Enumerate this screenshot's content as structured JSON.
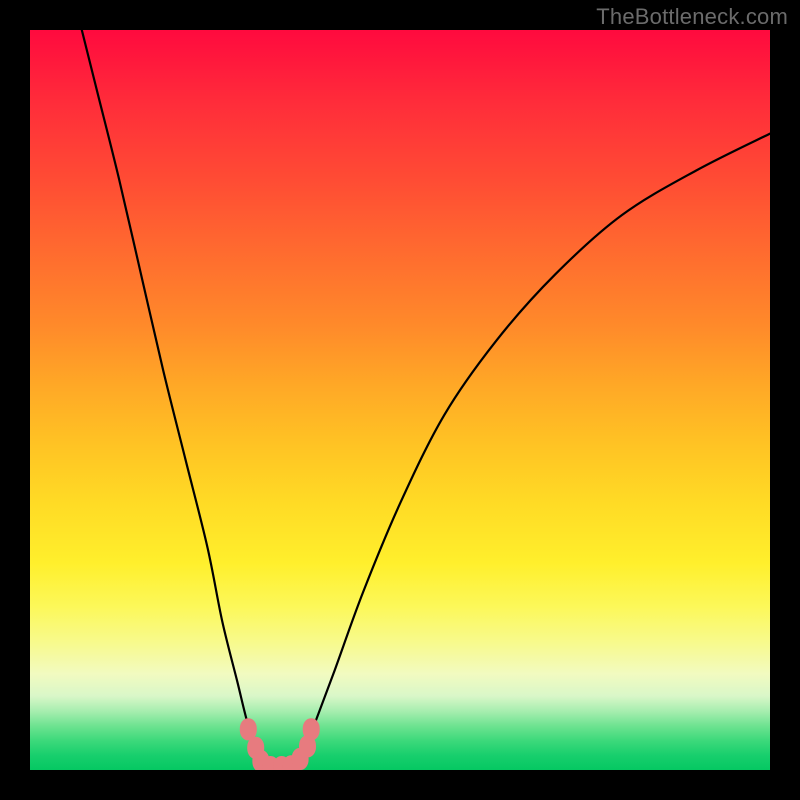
{
  "watermark": "TheBottleneck.com",
  "chart_data": {
    "type": "line",
    "title": "",
    "xlabel": "",
    "ylabel": "",
    "xlim": [
      0,
      100
    ],
    "ylim": [
      0,
      100
    ],
    "series": [
      {
        "name": "left-curve",
        "x": [
          7,
          9,
          12,
          15,
          18,
          21,
          24,
          26,
          28,
          29.5,
          31,
          32
        ],
        "y": [
          100,
          92,
          80,
          67,
          54,
          42,
          30,
          20,
          12,
          6,
          2,
          0
        ]
      },
      {
        "name": "right-curve",
        "x": [
          36,
          38,
          41,
          45,
          50,
          56,
          63,
          71,
          80,
          90,
          100
        ],
        "y": [
          0,
          5,
          13,
          24,
          36,
          48,
          58,
          67,
          75,
          81,
          86
        ]
      }
    ],
    "markers": {
      "name": "bottleneck-region",
      "color": "#e77b7f",
      "points": [
        {
          "x": 29.5,
          "y": 5.5
        },
        {
          "x": 30.5,
          "y": 3.0
        },
        {
          "x": 31.2,
          "y": 1.2
        },
        {
          "x": 32.5,
          "y": 0.4
        },
        {
          "x": 34.0,
          "y": 0.4
        },
        {
          "x": 35.3,
          "y": 0.5
        },
        {
          "x": 36.5,
          "y": 1.5
        },
        {
          "x": 37.5,
          "y": 3.2
        },
        {
          "x": 38.0,
          "y": 5.5
        }
      ]
    },
    "gradient_stops": [
      {
        "pos": 0,
        "color": "#ff0a3e"
      },
      {
        "pos": 100,
        "color": "#05c862"
      }
    ]
  }
}
